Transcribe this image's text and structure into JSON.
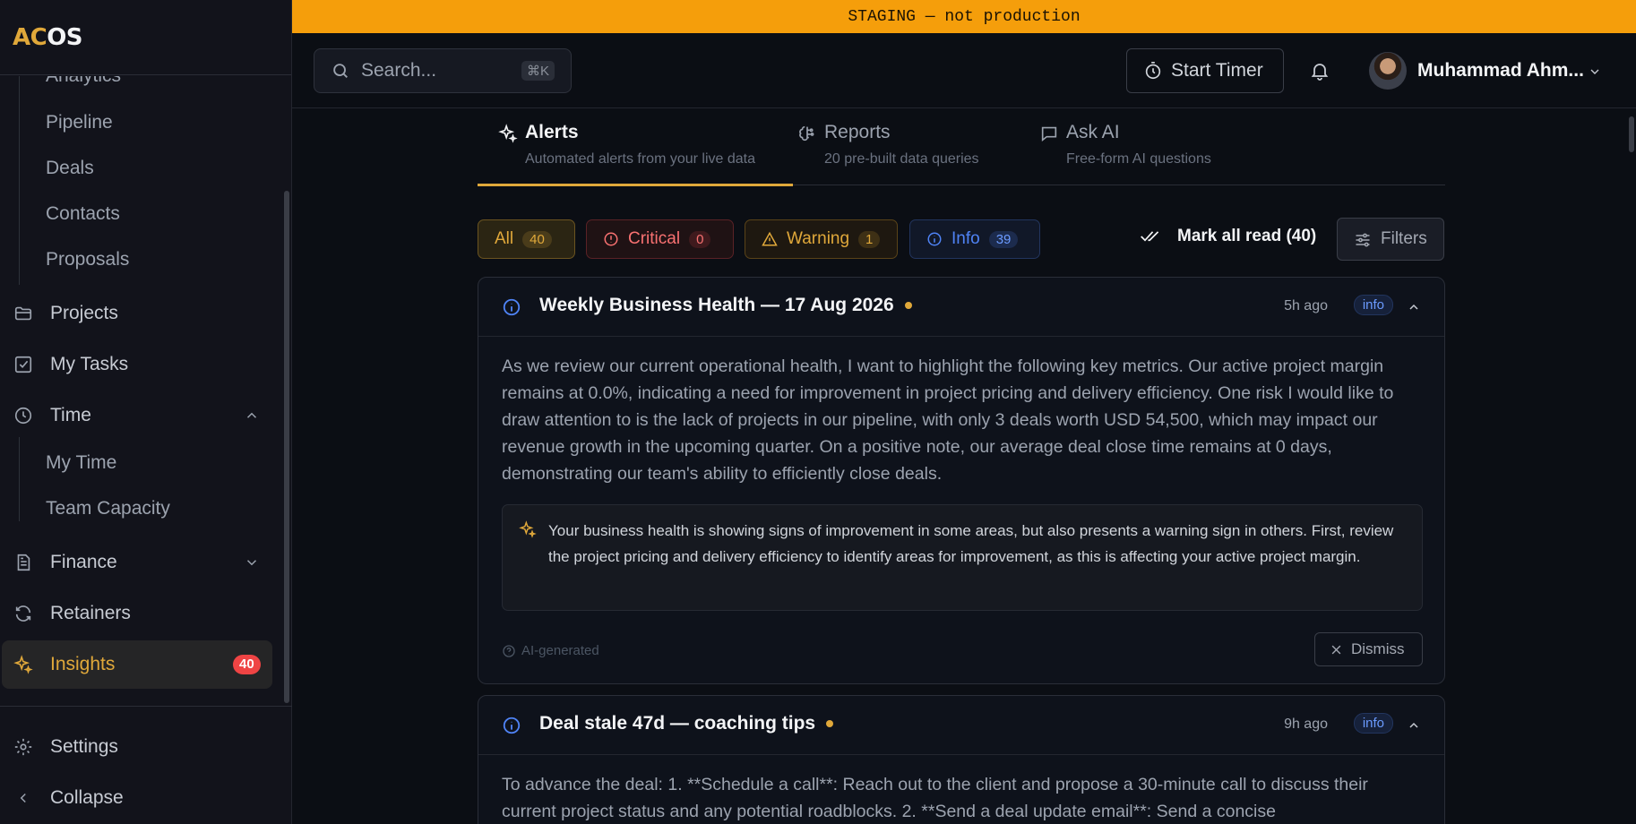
{
  "banner": {
    "text": "STAGING — not production"
  },
  "logo": {
    "part1": "AC",
    "part2": "OS"
  },
  "sidebar": {
    "sub_items_top": [
      "Analytics",
      "Pipeline",
      "Deals",
      "Contacts",
      "Proposals"
    ],
    "items": [
      {
        "label": "Projects",
        "icon": "folder-icon"
      },
      {
        "label": "My Tasks",
        "icon": "checkbox-icon"
      },
      {
        "label": "Time",
        "icon": "clock-icon",
        "expanded": true
      },
      {
        "label": "Finance",
        "icon": "document-icon",
        "expanded": false
      },
      {
        "label": "Retainers",
        "icon": "refresh-icon"
      },
      {
        "label": "Insights",
        "icon": "sparkle-icon",
        "active": true,
        "badge": "40"
      }
    ],
    "time_sub_items": [
      "My Time",
      "Team Capacity"
    ],
    "settings_label": "Settings",
    "collapse_label": "Collapse"
  },
  "header": {
    "search_placeholder": "Search...",
    "search_shortcut": "⌘K",
    "timer_label": "Start Timer",
    "user_name": "Muhammad Ahm..."
  },
  "tabs": [
    {
      "title": "Alerts",
      "subtitle": "Automated alerts from your live data",
      "icon": "sparkle-icon",
      "active": true
    },
    {
      "title": "Reports",
      "subtitle": "20 pre-built data queries",
      "icon": "brain-icon",
      "active": false
    },
    {
      "title": "Ask AI",
      "subtitle": "Free-form AI questions",
      "icon": "chat-icon",
      "active": false
    }
  ],
  "filters": {
    "all": {
      "label": "All",
      "count": "40"
    },
    "critical": {
      "label": "Critical",
      "count": "0"
    },
    "warning": {
      "label": "Warning",
      "count": "1"
    },
    "info": {
      "label": "Info",
      "count": "39"
    },
    "mark_all_read": "Mark all read (40)",
    "filters_button": "Filters"
  },
  "alerts": [
    {
      "title": "Weekly Business Health — 17 Aug 2026",
      "time_ago": "5h ago",
      "level": "info",
      "body": "As we review our current operational health, I want to highlight the following key metrics. Our active project margin remains at 0.0%, indicating a need for improvement in project pricing and delivery efficiency. One risk I would like to draw attention to is the lack of projects in our pipeline, with only 3 deals worth USD 54,500, which may impact our revenue growth in the upcoming quarter. On a positive note, our average deal close time remains at 0 days, demonstrating our team's ability to efficiently close deals.",
      "ai_summary": "Your business health is showing signs of improvement in some areas, but also presents a warning sign in others. First, review the project pricing and delivery efficiency to identify areas for improvement, as this is affecting your active project margin.",
      "ai_note": "AI-generated",
      "dismiss_label": "Dismiss"
    },
    {
      "title": "Deal stale 47d — coaching tips",
      "time_ago": "9h ago",
      "level": "info",
      "body": "To advance the deal: 1. **Schedule a call**: Reach out to the client and propose a 30-minute call to discuss their current project status and any potential roadblocks. 2. **Send a deal update email**: Send a concise"
    }
  ],
  "colors": {
    "accent": "#e0a83a",
    "banner": "#f59e0b",
    "critical": "#f87171",
    "info": "#4f83f5",
    "badge": "#ef4444"
  }
}
